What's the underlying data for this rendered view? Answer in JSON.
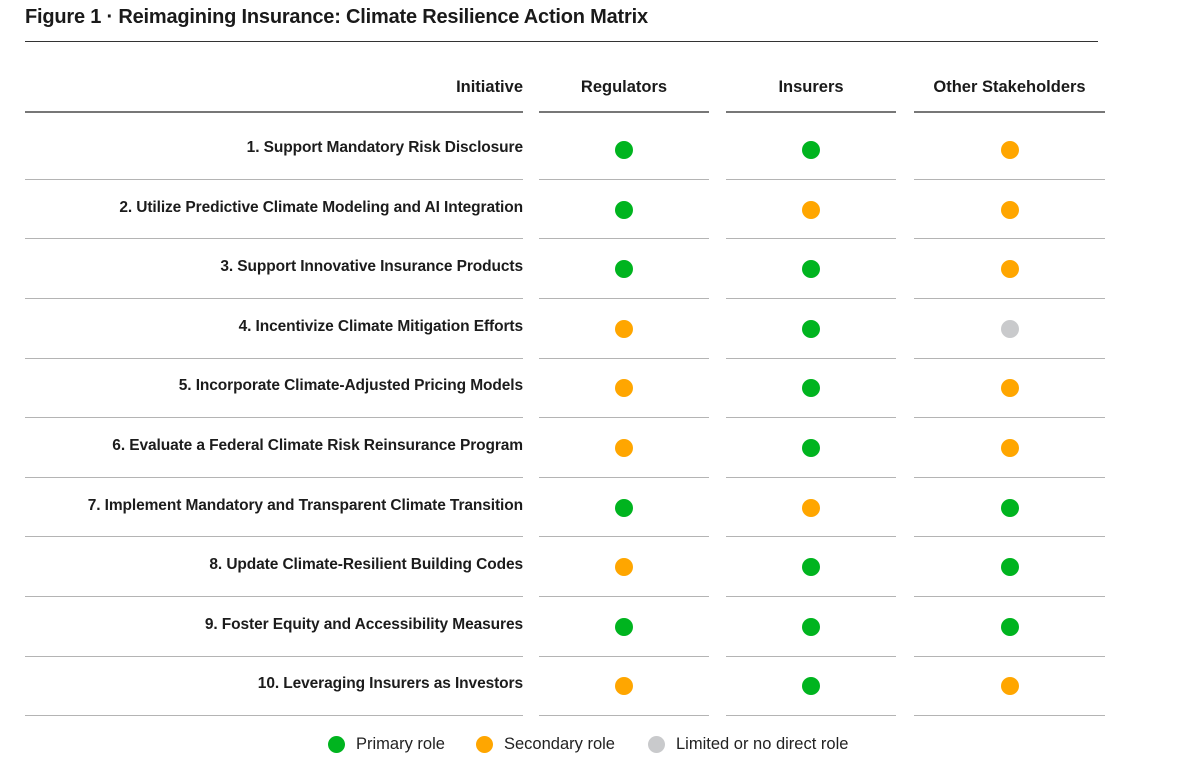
{
  "figure": {
    "title": "Figure 1  ·  Reimagining Insurance: Climate Resilience Action Matrix"
  },
  "colors": {
    "primary": "#00b41f",
    "secondary": "#ffa600",
    "limited": "#c9cacc"
  },
  "chart_data": {
    "type": "table",
    "title": "Figure 1 · Reimagining Insurance: Climate Resilience Action Matrix",
    "row_header": "Initiative",
    "columns": [
      "Regulators",
      "Insurers",
      "Other Stakeholders"
    ],
    "rows": [
      {
        "label": "1. Support Mandatory Risk Disclosure",
        "values": [
          "primary",
          "primary",
          "secondary"
        ]
      },
      {
        "label": "2. Utilize Predictive Climate Modeling and AI Integration",
        "values": [
          "primary",
          "secondary",
          "secondary"
        ]
      },
      {
        "label": "3. Support Innovative Insurance Products",
        "values": [
          "primary",
          "primary",
          "secondary"
        ]
      },
      {
        "label": "4. Incentivize Climate Mitigation Efforts",
        "values": [
          "secondary",
          "primary",
          "limited"
        ]
      },
      {
        "label": "5. Incorporate Climate-Adjusted Pricing Models",
        "values": [
          "secondary",
          "primary",
          "secondary"
        ]
      },
      {
        "label": "6. Evaluate a Federal Climate Risk Reinsurance Program",
        "values": [
          "secondary",
          "primary",
          "secondary"
        ]
      },
      {
        "label": "7. Implement Mandatory and Transparent Climate Transition",
        "values": [
          "primary",
          "secondary",
          "primary"
        ]
      },
      {
        "label": "8. Update Climate-Resilient Building Codes",
        "values": [
          "secondary",
          "primary",
          "primary"
        ]
      },
      {
        "label": "9. Foster Equity and Accessibility Measures",
        "values": [
          "primary",
          "primary",
          "primary"
        ]
      },
      {
        "label": "10. Leveraging Insurers as Investors",
        "values": [
          "secondary",
          "primary",
          "secondary"
        ]
      }
    ],
    "legend": [
      {
        "key": "primary",
        "label": "Primary role"
      },
      {
        "key": "secondary",
        "label": "Secondary role"
      },
      {
        "key": "limited",
        "label": "Limited or no direct role"
      }
    ],
    "legend_position": "bottom-center"
  }
}
